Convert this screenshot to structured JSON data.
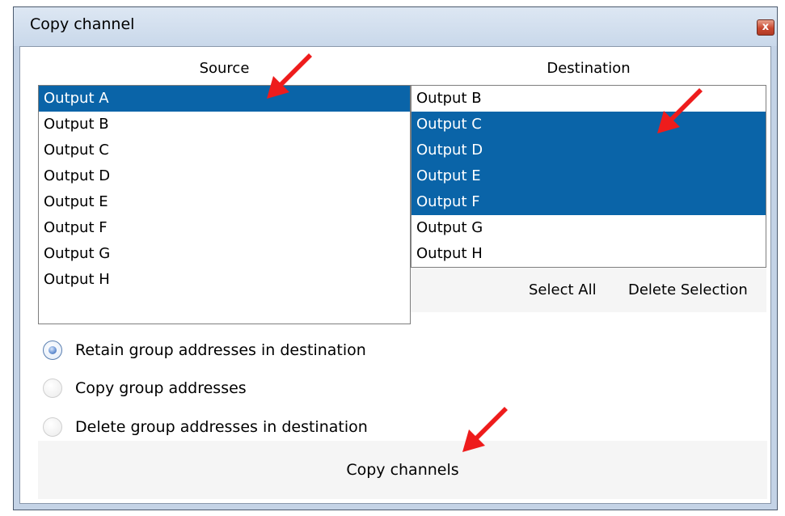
{
  "window": {
    "title": "Copy channel",
    "close_glyph": "x"
  },
  "source": {
    "header": "Source",
    "items": [
      {
        "label": "Output A",
        "selected": true
      },
      {
        "label": "Output B",
        "selected": false
      },
      {
        "label": "Output C",
        "selected": false
      },
      {
        "label": "Output D",
        "selected": false
      },
      {
        "label": "Output E",
        "selected": false
      },
      {
        "label": "Output F",
        "selected": false
      },
      {
        "label": "Output G",
        "selected": false
      },
      {
        "label": "Output H",
        "selected": false
      }
    ]
  },
  "destination": {
    "header": "Destination",
    "items": [
      {
        "label": "Output B",
        "selected": false
      },
      {
        "label": "Output C",
        "selected": true
      },
      {
        "label": "Output D",
        "selected": true
      },
      {
        "label": "Output E",
        "selected": true
      },
      {
        "label": "Output F",
        "selected": true
      },
      {
        "label": "Output G",
        "selected": false
      },
      {
        "label": "Output H",
        "selected": false
      }
    ],
    "select_all_label": "Select All",
    "delete_selection_label": "Delete Selection"
  },
  "options": [
    {
      "label": "Retain group addresses in destination",
      "checked": true
    },
    {
      "label": "Copy group addresses",
      "checked": false
    },
    {
      "label": "Delete group addresses in destination",
      "checked": false
    }
  ],
  "footer": {
    "copy_button_label": "Copy channels"
  },
  "colors": {
    "selection": "#0a64a8",
    "annotation_arrow": "#ee1c1c"
  },
  "annotations": {
    "arrow_icon": "red-arrow-icon"
  }
}
